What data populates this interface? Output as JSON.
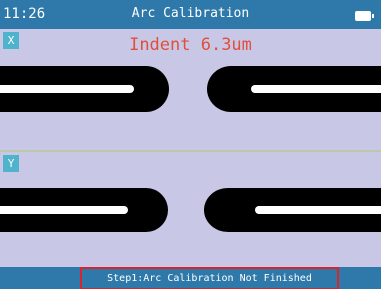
{
  "header": {
    "time": "11:26",
    "title": "Arc Calibration",
    "battery_icon": "battery-full-icon"
  },
  "panel_x": {
    "axis_label": "X",
    "indent_text": "Indent 6.3um"
  },
  "panel_y": {
    "axis_label": "Y"
  },
  "footer": {
    "status": "Step1:Arc Calibration Not Finished"
  },
  "colors": {
    "header_bg": "#2e79a9",
    "view_bg": "#c8c8e6",
    "fiber": "#000000",
    "fiber_core": "#ffffff",
    "indent_text": "#e04f3c",
    "status_border": "#d8252b",
    "axis_tag_bg": "#4fb3cc"
  }
}
